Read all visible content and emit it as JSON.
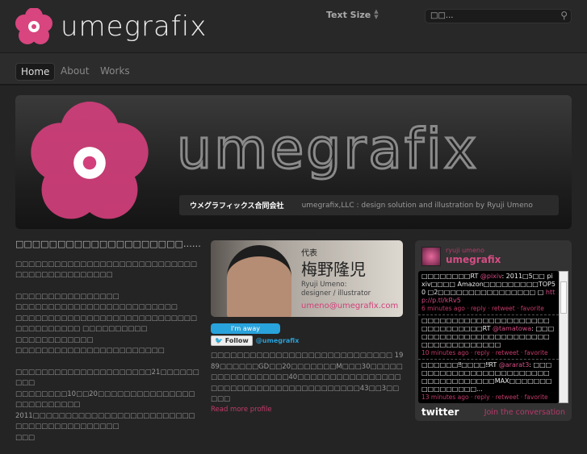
{
  "header": {
    "logo": "umegrafix",
    "text_size_label": "Text Size",
    "search_placeholder": "□□..."
  },
  "nav": [
    {
      "label": "Home",
      "active": true
    },
    {
      "label": "About"
    },
    {
      "label": "Works"
    }
  ],
  "hero": {
    "word": "umegrafix",
    "company_jp": "ウメグラフィックス合同会社",
    "tagline": "umegrafix,LLC : design solution and illustration by Ryuji Umeno"
  },
  "left": {
    "title": "□□□□□□□□□□□□□□□□□□□□……",
    "p1": "□□□□□□□□□□□□□□□□□□□□□□□□□□□□□□□□□□□□□□□□□□□",
    "p2": [
      "□□□□□□□□□□□□□□□□",
      "□□□□□□□□□□□□□□□□□□□□□□□□□",
      "□□□□□□□□□□□□□□□□□□□□□□□□□□□□□□□□□□□□□□ □□□□□□□□□□",
      "□□□□□□□□□□□□",
      "□□□□□□□□□□□□□□□□□□□□□□□"
    ],
    "p3": [
      "□□□□□□□□□□□□□□□□□□□□□21□□□□□□□□□",
      "□□□□□□□□10□□20□□□□□□□□□□□□□□□□□□□□□□□□□",
      "2011□□□□□□□□□□□□□□□□□□□□□□□□□□□□□□□□□□□□□□□□□",
      "□□□"
    ]
  },
  "profile": {
    "role": "代表",
    "name_jp": "梅野隆児",
    "name_en": "Ryuji Umeno:",
    "title": "designer / illustrator",
    "email": "umeno@umegrafix.com",
    "away": "I'm away",
    "follow": "Follow",
    "handle": "@umegrafix",
    "bio": "□□□□□□□□□□□□□□□□□□□□□□□□□□□□ 1989□□□□□□GD□□20□□□□□□□M□□□30□□□□□□□□□□□□□□□□□40□□□□□□□□□□□□□□□□□□□□□□□□□□□□□□□□□□□□□□□43□□3□□□□□",
    "more": "Read more profile"
  },
  "twitter": {
    "name": "ryuji umeno",
    "user": "umegrafix",
    "tweets": [
      {
        "text": "□□□□□□□□RT ",
        "mention": "@pixiv",
        "rest": ": 2011□5□□ pixiv□□□□ Amazon□□□□□□□□□TOP50 □2□□□□□□□□□□□□□□□□ □ ",
        "link": "http://p.tl/kRv5",
        "meta": "6 minutes ago · reply · retweet · favorite"
      },
      {
        "text": "□□□□□□□□□□□□□□□□□□□□□□□□□□□□□□□RT ",
        "mention": "@tamatowa",
        "rest": ": □□□□□□□□□□□□□□□□□□□□□□□□□□□□□□□□□□□□□",
        "link": "",
        "meta": "10 minutes ago · reply · retweet · favorite"
      },
      {
        "text": "□□□□□□‼□□□□‼RT ",
        "mention": "@ararat3",
        "rest": ": □□□□□□□□□□□□□□□□□□□□□□□□□□□□□□□□□□□□MAX□□□□□□□□□□□□□□□□...",
        "link": "",
        "meta": "13 minutes ago · reply · retweet · favorite"
      }
    ],
    "logo": "twitter",
    "join": "Join the conversation"
  }
}
